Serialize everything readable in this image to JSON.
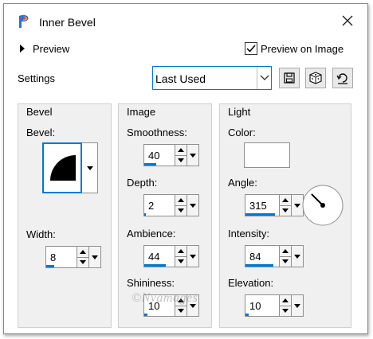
{
  "window": {
    "title": "Inner Bevel"
  },
  "icons": {
    "app": "paintshop-app-icon",
    "close": "close-icon",
    "save": "floppy-disk-icon",
    "randomize": "dice-icon",
    "reset": "reset-arrow-icon"
  },
  "header": {
    "preview_label": "Preview",
    "preview_on_image_label": "Preview on Image",
    "preview_on_image_checked": true
  },
  "settings": {
    "label": "Settings",
    "selected": "Last Used"
  },
  "bevel_group": {
    "title": "Bevel",
    "bevel_label": "Bevel:",
    "width_label": "Width:",
    "width_value": "8",
    "width_fill": 0.25
  },
  "image_group": {
    "title": "Image",
    "smoothness_label": "Smoothness:",
    "smoothness_value": "40",
    "smoothness_fill": 0.4,
    "depth_label": "Depth:",
    "depth_value": "2",
    "depth_fill": 0.05,
    "ambience_label": "Ambience:",
    "ambience_value": "44",
    "ambience_fill": 0.72,
    "shininess_label": "Shininess:",
    "shininess_value": "10",
    "shininess_fill": 0.1
  },
  "light_group": {
    "title": "Light",
    "color_label": "Color:",
    "color_value": "#ffffff",
    "angle_label": "Angle:",
    "angle_value": "315",
    "angle_fill": 0.875,
    "intensity_label": "Intensity:",
    "intensity_value": "84",
    "intensity_fill": 0.84,
    "elevation_label": "Elevation:",
    "elevation_value": "10",
    "elevation_fill": 0.1
  },
  "watermark": "©Nvamages",
  "colors": {
    "accent": "#0078d7",
    "panel": "#f0f0f0",
    "border": "#cfcfcf"
  }
}
